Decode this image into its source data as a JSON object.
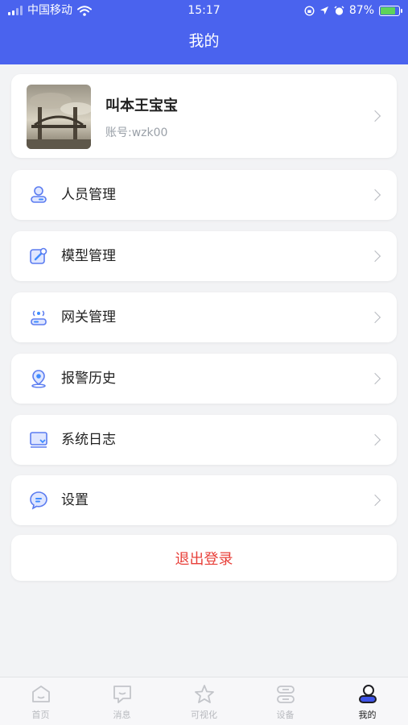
{
  "status_bar": {
    "carrier": "中国移动",
    "time": "15:17",
    "battery": "87%",
    "battery_level": 0.87
  },
  "header": {
    "title": "我的"
  },
  "profile": {
    "name": "叫本王宝宝",
    "account": "账号:wzk00"
  },
  "menu": {
    "items": [
      {
        "label": "人员管理",
        "icon": "person-badge-icon"
      },
      {
        "label": "模型管理",
        "icon": "wrench-edit-icon"
      },
      {
        "label": "网关管理",
        "icon": "gateway-router-icon"
      },
      {
        "label": "报警历史",
        "icon": "location-pin-icon"
      },
      {
        "label": "系统日志",
        "icon": "log-book-icon"
      },
      {
        "label": "设置",
        "icon": "settings-chat-icon"
      }
    ]
  },
  "logout_label": "退出登录",
  "tabbar": {
    "tabs": [
      {
        "label": "首页",
        "icon": "home-icon"
      },
      {
        "label": "消息",
        "icon": "message-icon"
      },
      {
        "label": "可视化",
        "icon": "star-icon"
      },
      {
        "label": "设备",
        "icon": "device-icon"
      },
      {
        "label": "我的",
        "icon": "profile-icon",
        "active": true
      }
    ]
  },
  "colors": {
    "primary": "#4a63ee",
    "logout_text": "#e8403a",
    "icon_accent": "#5b7cf0"
  }
}
